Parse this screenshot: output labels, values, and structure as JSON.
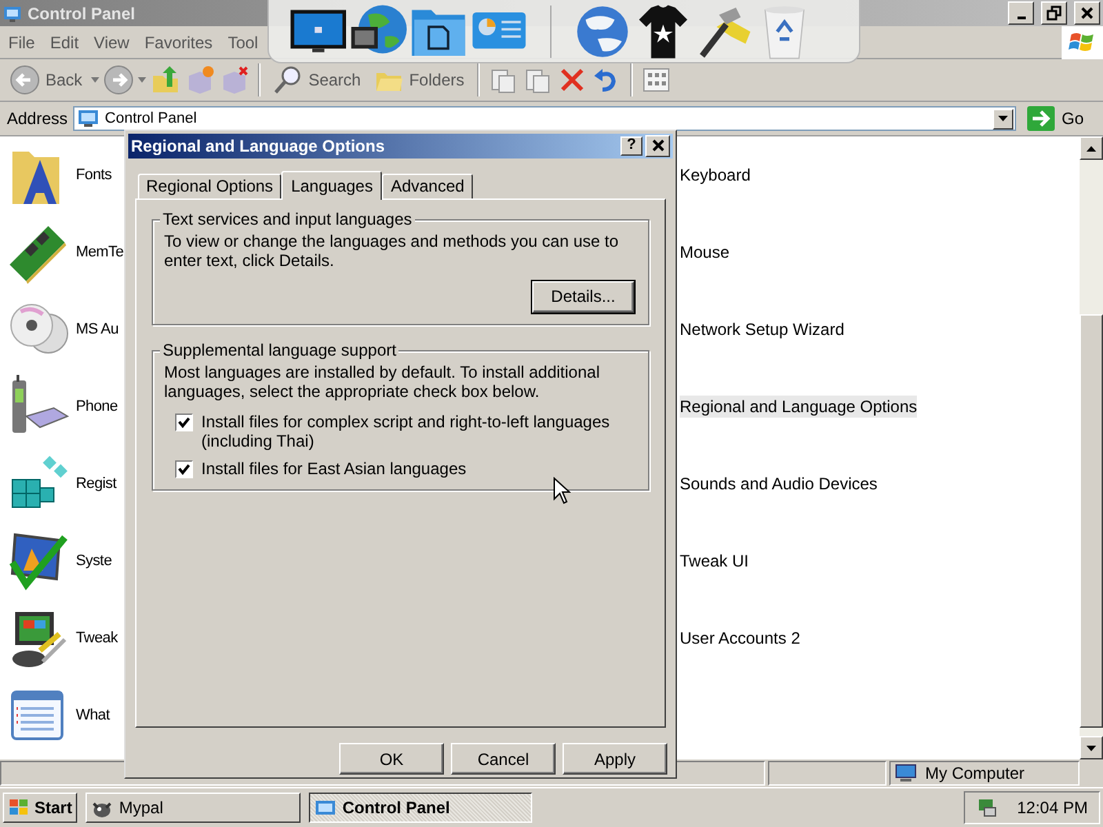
{
  "window": {
    "title": "Control Panel",
    "menu": [
      "File",
      "Edit",
      "View",
      "Favorites",
      "Tool"
    ],
    "toolbar": {
      "back": "Back",
      "search": "Search",
      "folders": "Folders"
    },
    "address": {
      "label": "Address",
      "value": "Control Panel",
      "go": "Go"
    }
  },
  "left_column": [
    {
      "label": "Fonts"
    },
    {
      "label": "MemTe"
    },
    {
      "label": "MS Au"
    },
    {
      "label": "Phone"
    },
    {
      "label": "Regist"
    },
    {
      "label": "Syste"
    },
    {
      "label": "Tweak"
    },
    {
      "label": "What"
    }
  ],
  "right_column": [
    {
      "label": "Keyboard",
      "selected": false
    },
    {
      "label": "Mouse",
      "selected": false
    },
    {
      "label": "Network Setup Wizard",
      "selected": false
    },
    {
      "label": "Regional and Language Options",
      "selected": true
    },
    {
      "label": "Sounds and Audio Devices",
      "selected": false
    },
    {
      "label": "Tweak UI",
      "selected": false
    },
    {
      "label": "User Accounts 2",
      "selected": false
    }
  ],
  "dialog": {
    "title": "Regional and Language Options",
    "help": "?",
    "tabs": [
      {
        "label": "Regional Options",
        "selected": false
      },
      {
        "label": "Languages",
        "selected": true
      },
      {
        "label": "Advanced",
        "selected": false
      }
    ],
    "groups": [
      {
        "legend": "Text services and input languages",
        "text": "To view or change the languages and methods you can use to enter text, click Details.",
        "button": "Details..."
      },
      {
        "legend": "Supplemental language support",
        "text": "Most languages are installed by default. To install additional languages, select the appropriate check box below.",
        "checkboxes": [
          {
            "label": "Install files for complex script and right-to-left languages (including Thai)",
            "checked": true
          },
          {
            "label": "Install files for East Asian languages",
            "checked": true
          }
        ]
      }
    ],
    "buttons": [
      "OK",
      "Cancel",
      "Apply"
    ]
  },
  "status_bar": {
    "location": "My Computer"
  },
  "taskbar": {
    "start": "Start",
    "tasks": [
      {
        "label": "Mypal",
        "selected": false
      },
      {
        "label": "Control Panel",
        "selected": true
      }
    ],
    "clock": "12:04 PM"
  }
}
